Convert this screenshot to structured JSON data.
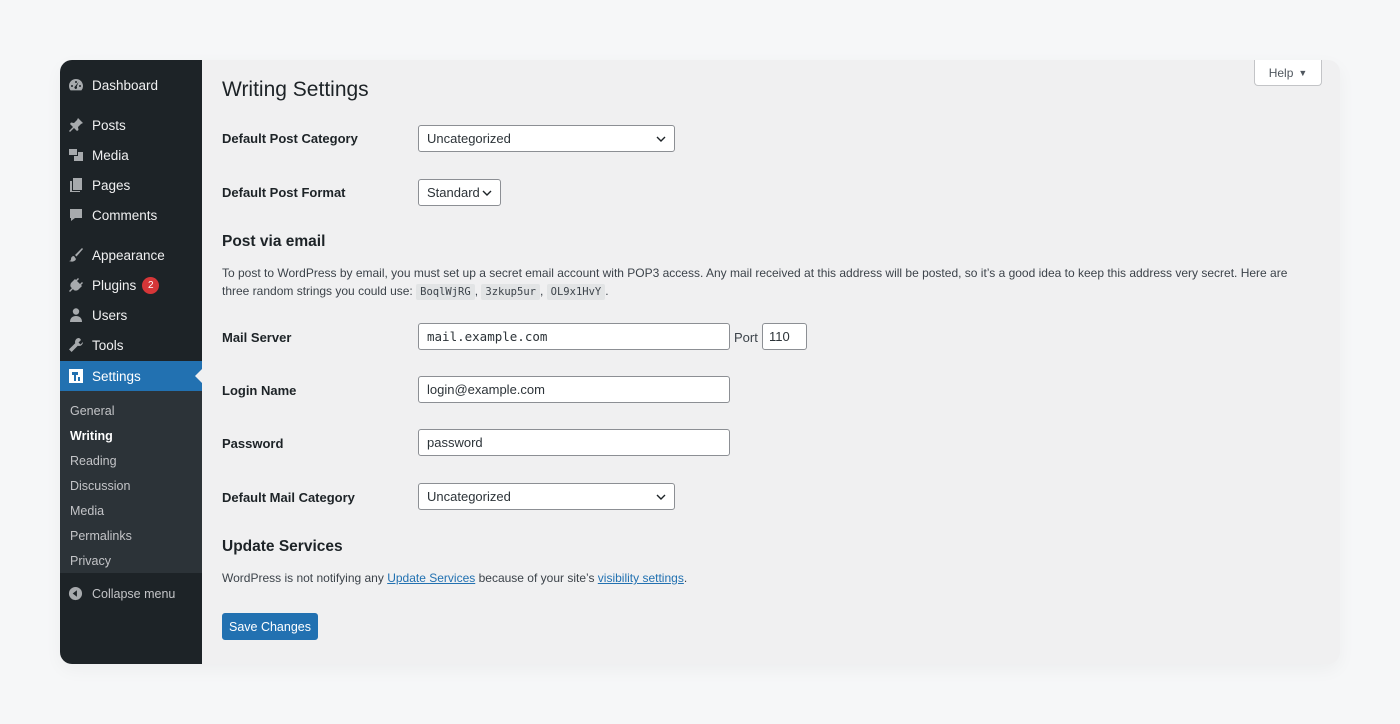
{
  "sidebar": {
    "items": [
      {
        "label": "Dashboard",
        "icon": "dashboard-icon"
      },
      {
        "label": "Posts",
        "icon": "pin-icon"
      },
      {
        "label": "Media",
        "icon": "media-icon"
      },
      {
        "label": "Pages",
        "icon": "pages-icon"
      },
      {
        "label": "Comments",
        "icon": "comments-icon"
      },
      {
        "label": "Appearance",
        "icon": "brush-icon"
      },
      {
        "label": "Plugins",
        "icon": "plug-icon",
        "badge": "2"
      },
      {
        "label": "Users",
        "icon": "user-icon"
      },
      {
        "label": "Tools",
        "icon": "wrench-icon"
      },
      {
        "label": "Settings",
        "icon": "settings-icon"
      }
    ],
    "submenu": [
      "General",
      "Writing",
      "Reading",
      "Discussion",
      "Media",
      "Permalinks",
      "Privacy"
    ],
    "collapse_label": "Collapse menu"
  },
  "help": {
    "label": "Help",
    "arrow": "▼"
  },
  "page_title": "Writing Settings",
  "fields": {
    "default_post_category": {
      "label": "Default Post Category",
      "value": "Uncategorized"
    },
    "default_post_format": {
      "label": "Default Post Format",
      "value": "Standard"
    },
    "mail_server": {
      "label": "Mail Server",
      "value": "mail.example.com",
      "port_label": "Port",
      "port_value": "110"
    },
    "login_name": {
      "label": "Login Name",
      "value": "login@example.com"
    },
    "password": {
      "label": "Password",
      "value": "password"
    },
    "default_mail_category": {
      "label": "Default Mail Category",
      "value": "Uncategorized"
    }
  },
  "post_via_email": {
    "heading": "Post via email",
    "desc_1": "To post to WordPress by email, you must set up a secret email account with POP3 access. Any mail received at this address will be posted, so it’s a good idea to keep this address very secret. Here are three random strings you could use:",
    "codes": [
      "BoqlWjRG",
      "3zkup5ur",
      "OL9x1HvY"
    ],
    "sep": ",",
    "end": "."
  },
  "update_services": {
    "heading": "Update Services",
    "text_1": "WordPress is not notifying any",
    "link_1": "Update Services",
    "text_2": "because of your site’s",
    "link_2": "visibility settings",
    "text_3": "."
  },
  "save_label": "Save Changes"
}
